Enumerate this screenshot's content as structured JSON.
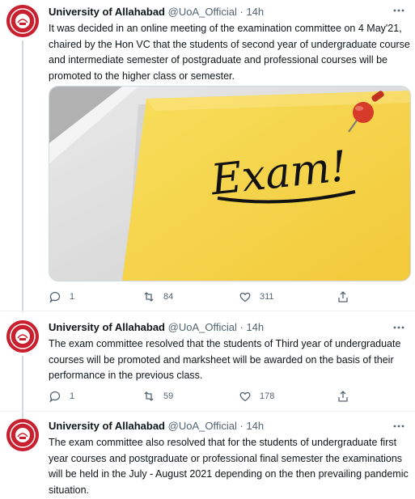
{
  "tweets": [
    {
      "name": "University of Allahabad",
      "handle": "@UoA_Official",
      "sep": "·",
      "time": "14h",
      "text": "It was decided in an online meeting  of the examination committee on 4 May'21, chaired by the Hon VC that the students of second year of undergraduate course and intermediate semester of postgraduate and professional courses will be promoted to the higher class or semester.",
      "media_text": "Exam!",
      "replies": "1",
      "retweets": "84",
      "likes": "311"
    },
    {
      "name": "University of Allahabad",
      "handle": "@UoA_Official",
      "sep": "·",
      "time": "14h",
      "text": "The exam committee resolved that the students of Third year of undergraduate courses will be promoted and marksheet will be awarded on the basis of their performance in the previous class.",
      "replies": "1",
      "retweets": "59",
      "likes": "178"
    },
    {
      "name": "University of Allahabad",
      "handle": "@UoA_Official",
      "sep": "·",
      "time": "14h",
      "text": "The exam committee also resolved that for the students of undergraduate first year courses and postgraduate or professional final semester the examinations will be held in the July - August 2021 depending on the then prevailing pandemic situation."
    }
  ],
  "icons": {
    "more": "more-icon",
    "reply": "reply-icon",
    "retweet": "retweet-icon",
    "like": "like-icon",
    "share": "share-icon"
  },
  "colors": {
    "avatar": "#c8202f",
    "note": "#f6d64a",
    "pin": "#d63b2a",
    "secondary": "#536471"
  }
}
